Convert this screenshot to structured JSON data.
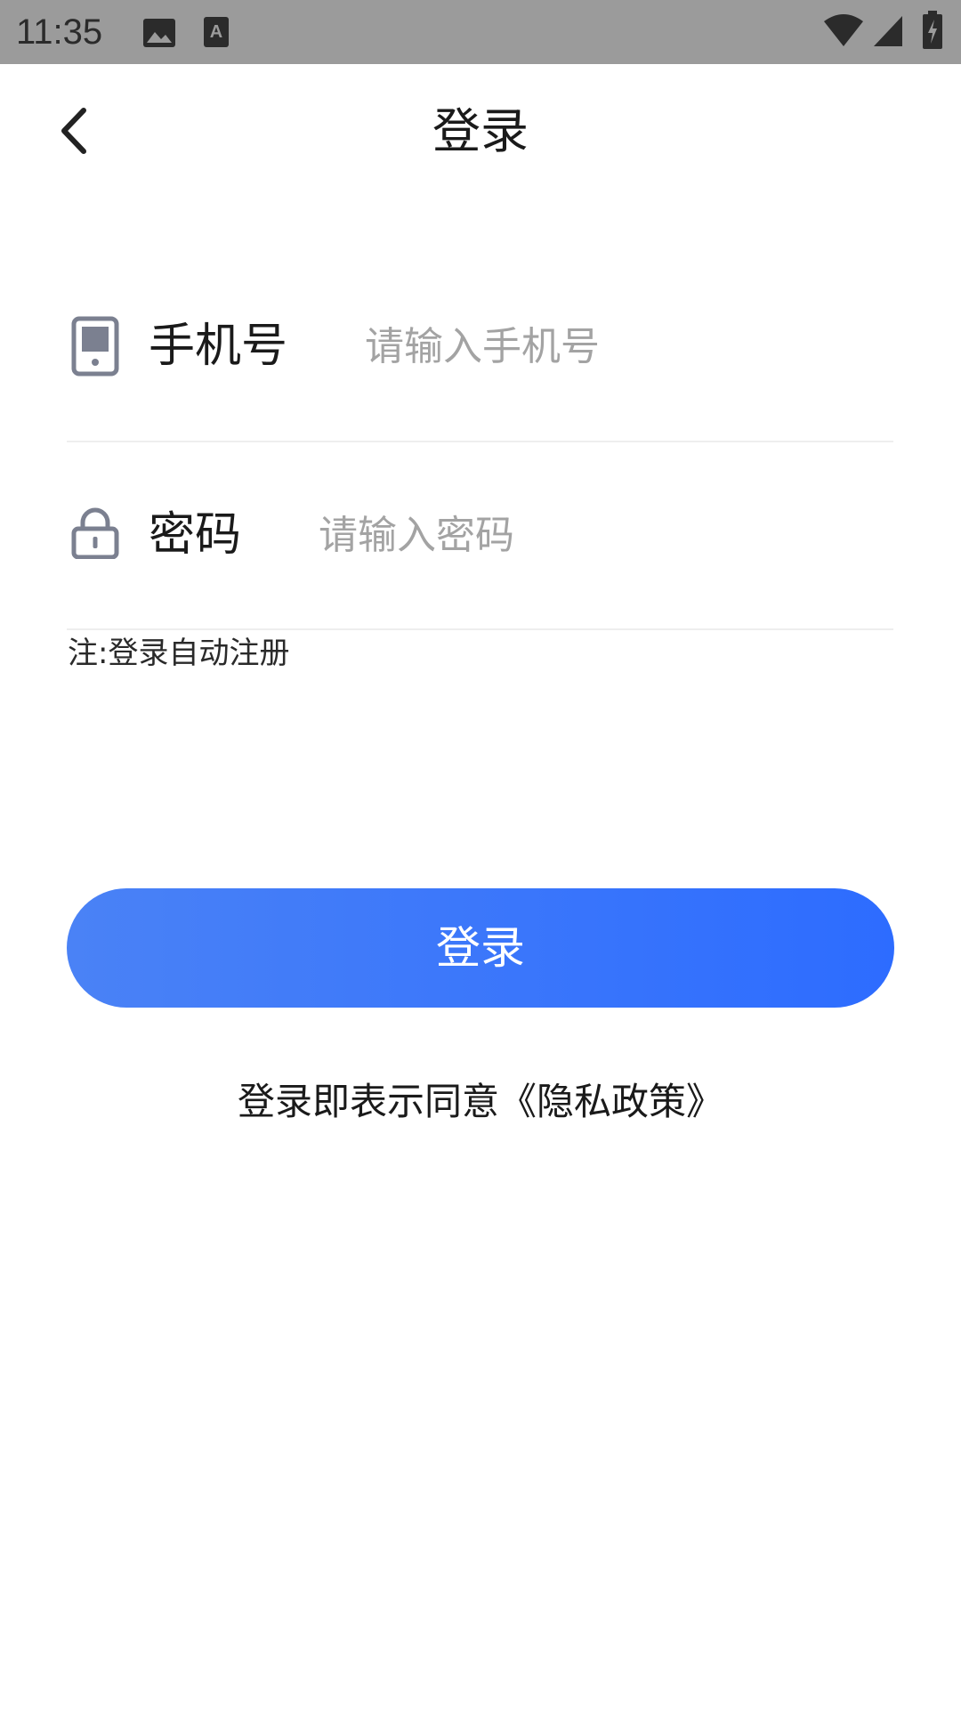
{
  "status_bar": {
    "time": "11:35",
    "icons": [
      "image-icon",
      "text-a-icon",
      "wifi-icon",
      "signal-icon",
      "battery-charging-icon"
    ]
  },
  "nav": {
    "back_icon": "chevron-left-icon",
    "title": "登录"
  },
  "form": {
    "phone": {
      "icon": "phone-icon",
      "label": "手机号",
      "placeholder": "请输入手机号",
      "value": ""
    },
    "password": {
      "icon": "lock-icon",
      "label": "密码",
      "placeholder": "请输入密码",
      "value": ""
    },
    "note": "注:登录自动注册"
  },
  "login_button": {
    "label": "登录"
  },
  "agreement": {
    "prefix": "登录即表示同意",
    "policy_link": "《隐私政策》"
  },
  "colors": {
    "status_bar_bg": "#9b9b9b",
    "button_gradient_start": "#4a82f6",
    "button_gradient_end": "#2d6cff",
    "icon_gray": "#7b8090",
    "placeholder_gray": "#a3a3a3",
    "divider": "#eeeeee"
  }
}
